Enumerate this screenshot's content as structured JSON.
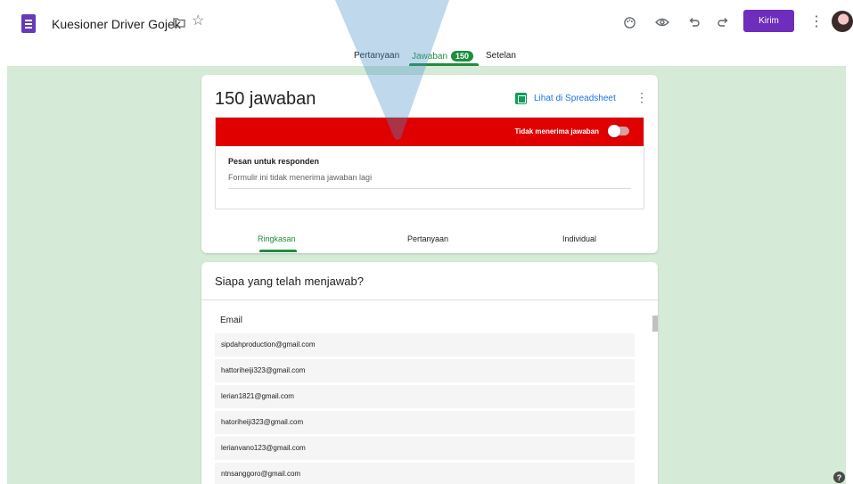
{
  "header": {
    "title": "Kuesioner Driver Gojek",
    "send_label": "Kirim",
    "icons": [
      "form-icon",
      "folder-icon",
      "star-icon",
      "palette-icon",
      "preview-eye-icon",
      "undo-icon",
      "redo-icon",
      "more-vert-icon",
      "avatar"
    ]
  },
  "tabs": {
    "questions": "Pertanyaan",
    "responses": "Jawaban",
    "responses_count": "150",
    "settings": "Setelan"
  },
  "summary": {
    "response_count": "150 jawaban",
    "sheet_link": "Lihat di Spreadsheet",
    "accepting_label": "Tidak menerima jawaban",
    "accepting_on": false,
    "message_label": "Pesan untuk responden",
    "message_value": "Formulir ini tidak menerima jawaban lagi",
    "sub_tabs": [
      "Ringkasan",
      "Pertanyaan",
      "Individual"
    ],
    "active_sub_tab": "Ringkasan"
  },
  "who_responded": {
    "title": "Siapa yang telah menjawab?",
    "column_header": "Email",
    "emails": [
      "sipdahproduction@gmail.com",
      "hattoriheiji323@gmail.com",
      "lerian1821@gmail.com",
      "hatoriheiji323@gmail.com",
      "lerianvano123@gmail.com",
      "ntnsanggoro@gmail.com"
    ]
  },
  "help_label": "?",
  "colors": {
    "accent_purple": "#6f2dbd",
    "accent_green": "#1e8e3e",
    "canvas_green": "#d5ead7",
    "alert_red": "#e00000"
  }
}
